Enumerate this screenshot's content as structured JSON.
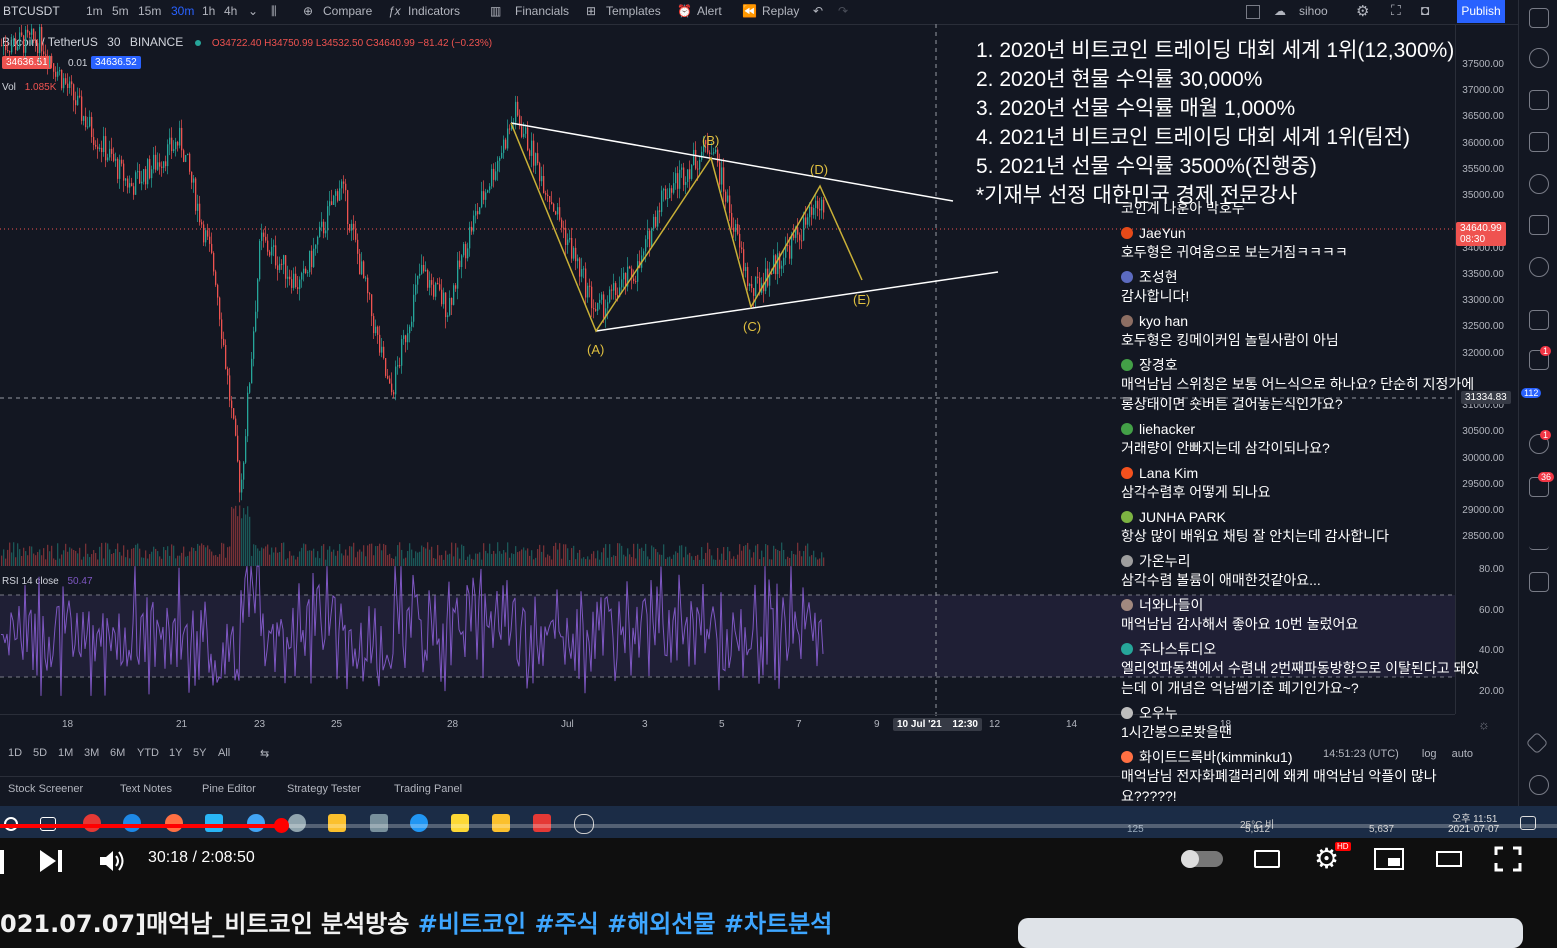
{
  "toolbar": {
    "symbol": "BTCUSDT",
    "intervals": [
      "1m",
      "5m",
      "15m",
      "30m",
      "1h",
      "4h"
    ],
    "active_interval": "30m",
    "compare": "Compare",
    "indicators": "Indicators",
    "financials": "Financials",
    "templates": "Templates",
    "alert": "Alert",
    "replay": "Replay",
    "user": "sihoo",
    "publish": "Publish"
  },
  "legend": {
    "name": "Bitcoin / TetherUS",
    "interval": "30",
    "exchange": "BINANCE",
    "ohlc": "O34722.40 H34750.99 L34532.50 C34640.99 −81.42 (−0.23%)",
    "bid": "34636.51",
    "spread": "0.01",
    "ask": "34636.52",
    "vol_label": "Vol",
    "vol_value": "1.085K",
    "rsi_label": "RSI 14 close",
    "rsi_value": "50.47"
  },
  "yaxis": {
    "price_ticks": [
      "37500.00",
      "37000.00",
      "36500.00",
      "36000.00",
      "35500.00",
      "35000.00",
      "34000.00",
      "33500.00",
      "33000.00",
      "32500.00",
      "32000.00",
      "31000.00",
      "30500.00",
      "30000.00",
      "29500.00",
      "29000.00",
      "28500.00"
    ],
    "rsi_ticks": [
      "80.00",
      "60.00",
      "40.00",
      "20.00"
    ],
    "last_price": "34640.99",
    "last_time": "08:30",
    "crosshair_price": "31334.83"
  },
  "xaxis": {
    "ticks": [
      "18",
      "21",
      "23",
      "25",
      "28",
      "Jul",
      "3",
      "5",
      "7",
      "9",
      "12",
      "14",
      "18"
    ],
    "crosshair_date": "10 Jul '21",
    "crosshair_time": "12:30",
    "clock": "14:51:23 (UTC)",
    "log": "log",
    "auto": "auto"
  },
  "chart_data": {
    "type": "candlestick",
    "title": "Bitcoin / TetherUS 30 BINANCE",
    "pattern_labels": [
      "(A)",
      "(B)",
      "(C)",
      "(D)",
      "(E)"
    ],
    "pattern_points": [
      {
        "label": "(A)",
        "date": "Jul 1",
        "price": 32800
      },
      {
        "label": "(B)",
        "date": "Jul 4",
        "price": 35950
      },
      {
        "label": "(C)",
        "date": "Jul 5",
        "price": 33100
      },
      {
        "label": "(D)",
        "date": "Jul 7",
        "price": 35450
      },
      {
        "label": "(E)",
        "date": "Jul 8",
        "price": 33600
      }
    ],
    "ylim": [
      28300,
      38200
    ],
    "rsi_ylim": [
      15,
      85
    ]
  },
  "overlay": {
    "lines": [
      "1. 2020년 비트코인 트레이딩 대회 세계 1위(12,300%)",
      "2. 2020년 현물 수익률 30,000%",
      "3. 2020년 선물 수익률 매월 1,000%",
      "4. 2021년 비트코인 트레이딩 대회 세계 1위(팀전)",
      "5. 2021년 선물 수익률 3500%(진행중)",
      "*기재부 선정 대한민국 경제 전문강사"
    ]
  },
  "chat": [
    {
      "name": "",
      "msg": "코인계 나훈아 박호두",
      "color": "#888888"
    },
    {
      "name": "JaeYun",
      "msg": "호두형은 귀여움으로 보는거짐ㅋㅋㅋㅋ",
      "color": "#e64a19"
    },
    {
      "name": "조성현",
      "msg": "감사합니다!",
      "color": "#5c6bc0"
    },
    {
      "name": "kyo han",
      "msg": "호두형은 킹메이커임 놀릴사람이 아님",
      "color": "#8d6e63"
    },
    {
      "name": "장경호",
      "msg": "매억남님 스위칭은 보통 어느식으로 하나요? 단순히 지정가에 롱상태이면 숏버튼 걸어놓는식인가요?",
      "color": "#43a047"
    },
    {
      "name": "liehacker",
      "msg": "거래량이 안빠지는데 삼각이되나요?",
      "color": "#43a047"
    },
    {
      "name": "Lana Kim",
      "msg": "삼각수렴후 어떻게 되나요",
      "color": "#f4511e"
    },
    {
      "name": "JUNHA PARK",
      "msg": "항상 많이 배워요 채팅 잘 안치는데 감사합니다",
      "color": "#7cb342"
    },
    {
      "name": "가온누리",
      "msg": "삼각수렴 볼륨이 애매한것같아요...",
      "color": "#9e9e9e"
    },
    {
      "name": "너와나들이",
      "msg": "매억남님 감사해서 좋아요 10번 눌렀어요",
      "color": "#a1887f"
    },
    {
      "name": "주나스튜디오",
      "msg": "엘리엇파동책에서 수렴내 2번째파동방향으로 이탈된다고 돼있는데 이 개념은 억남쌤기준 폐기인가요~?",
      "color": "#26a69a"
    },
    {
      "name": "오우누",
      "msg": "1시간봉으로봣을땐",
      "color": "#bdbdbd"
    },
    {
      "name": "화이트드록바(kimminku1)",
      "msg": "매억남님 전자화폐갤러리에 왜케 매억남님 악플이 많나요?????!",
      "color": "#ff7043"
    }
  ],
  "ranges": [
    "1D",
    "5D",
    "1M",
    "3M",
    "6M",
    "YTD",
    "1Y",
    "5Y",
    "All"
  ],
  "bottom_tabs": [
    "Stock Screener",
    "Text Notes",
    "Pine Editor",
    "Strategy Tester",
    "Trading Panel"
  ],
  "badges": {
    "b1": "1",
    "b112": "112",
    "b1b": "1",
    "b36": "36"
  },
  "taskbar": {
    "weather": "25°C 비",
    "time": "오후 11:51",
    "date": "2021-07-07",
    "left_count": "125",
    "mid_count": "5,512",
    "right_count": "5,637"
  },
  "player": {
    "time": "30:18 / 2:08:50",
    "progress": 0.235,
    "hd": "HD"
  },
  "video_title": {
    "prefix": "021.07.07]매억남_비트코인 분석방송 ",
    "tags": "#비트코인 #주식 #해외선물 #차트분석"
  }
}
